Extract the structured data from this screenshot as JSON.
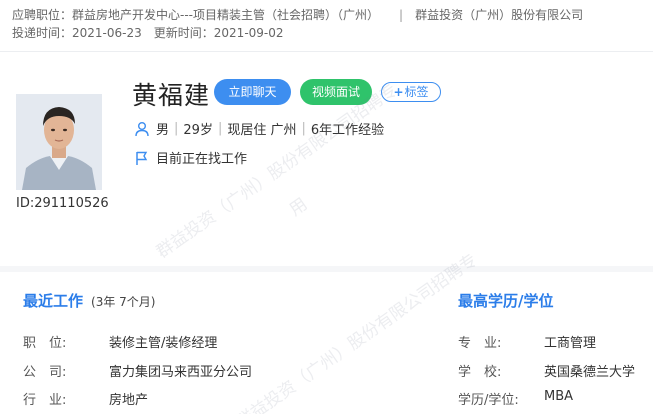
{
  "apply": {
    "position_label": "应聘职位：",
    "position_value": "群益房地产开发中心---项目精装主管（社会招聘）（广州）",
    "separator": "|",
    "company": "群益投资（广州）股份有限公司",
    "submit_label": "投递时间：",
    "submit_date": "2021-06-23",
    "update_label": "更新时间：",
    "update_date": "2021-09-02"
  },
  "profile": {
    "name": "黄福建",
    "id_text": "ID:291110526",
    "buttons": {
      "chat": "立即聊天",
      "video": "视频面试",
      "tag": "标签"
    },
    "gender": "男",
    "age": "29岁",
    "residence": "现居住 广州",
    "experience": "6年工作经验",
    "job_status": "目前正在找工作"
  },
  "recent_work": {
    "title": "最近工作",
    "duration": "(3年 7个月)",
    "fields": [
      {
        "label": "职　位:",
        "value": "装修主管/装修经理"
      },
      {
        "label": "公　司:",
        "value": "富力集团马来西亚分公司"
      },
      {
        "label": "行　业:",
        "value": "房地产"
      }
    ]
  },
  "education": {
    "title": "最高学历/学位",
    "fields": [
      {
        "label": "专　业:",
        "value": "工商管理"
      },
      {
        "label": "学　校:",
        "value": "英国桑德兰大学"
      },
      {
        "label": "学历/学位:",
        "value": "MBA"
      }
    ]
  },
  "watermark": {
    "line1": "群益投资（广州）股份有限公司招聘专",
    "line2": "用"
  },
  "colors": {
    "accent_blue": "#3d8ef0",
    "accent_green": "#2fc36b",
    "title_blue": "#2b7de9"
  }
}
